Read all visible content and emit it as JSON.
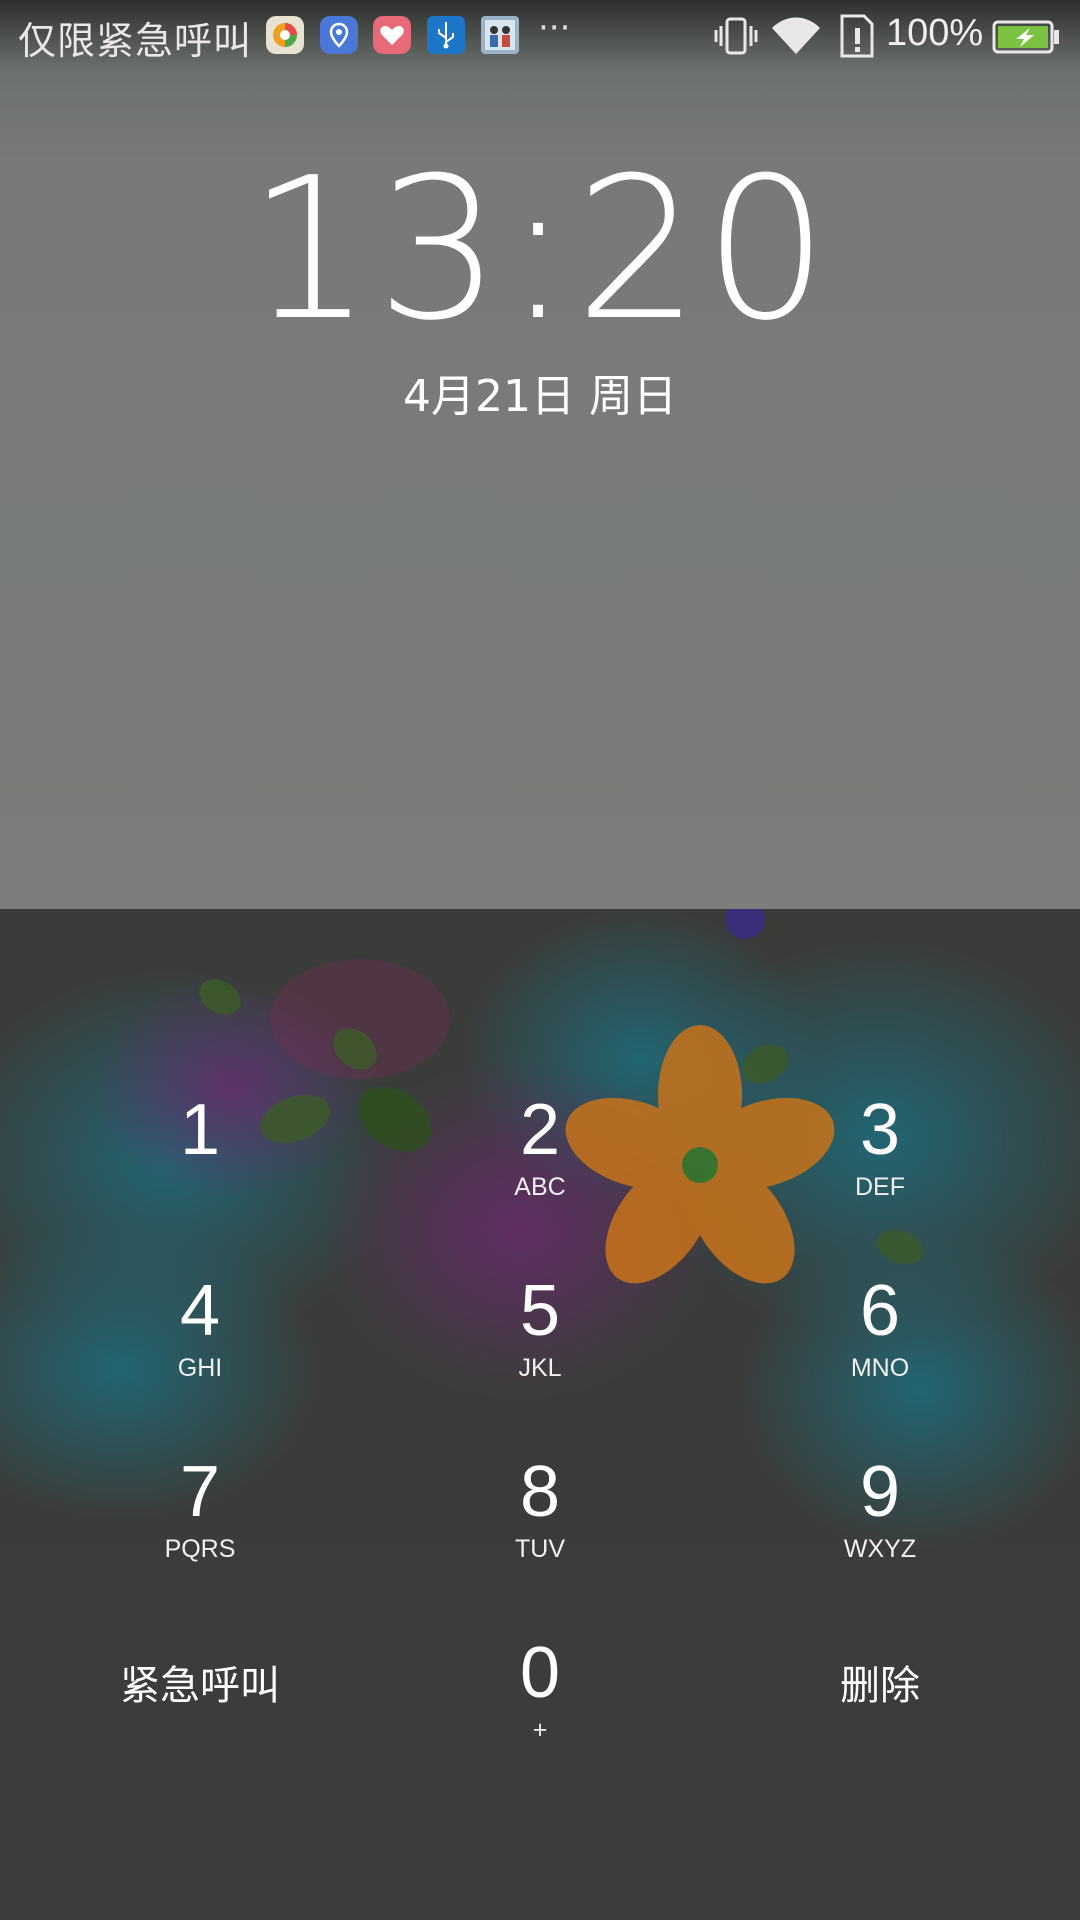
{
  "status_bar": {
    "carrier_text": "仅限紧急呼叫",
    "notification_icons": [
      "browser-app-icon",
      "location-app-icon",
      "health-app-icon",
      "usb-icon",
      "photo-thumbnail-icon"
    ],
    "more_indicator": "···",
    "system_icons": [
      "vibrate-icon",
      "wifi-icon",
      "sim-alert-icon"
    ],
    "battery_percent": "100%",
    "battery_color": "#7cc242"
  },
  "lock": {
    "time": "13:20",
    "date": "4月21日  周日"
  },
  "keypad": {
    "keys": [
      {
        "digit": "1",
        "letters": ""
      },
      {
        "digit": "2",
        "letters": "ABC"
      },
      {
        "digit": "3",
        "letters": "DEF"
      },
      {
        "digit": "4",
        "letters": "GHI"
      },
      {
        "digit": "5",
        "letters": "JKL"
      },
      {
        "digit": "6",
        "letters": "MNO"
      },
      {
        "digit": "7",
        "letters": "PQRS"
      },
      {
        "digit": "8",
        "letters": "TUV"
      },
      {
        "digit": "9",
        "letters": "WXYZ"
      },
      {
        "digit": "0",
        "letters": "+"
      }
    ],
    "emergency_label": "紧急呼叫",
    "delete_label": "删除"
  }
}
